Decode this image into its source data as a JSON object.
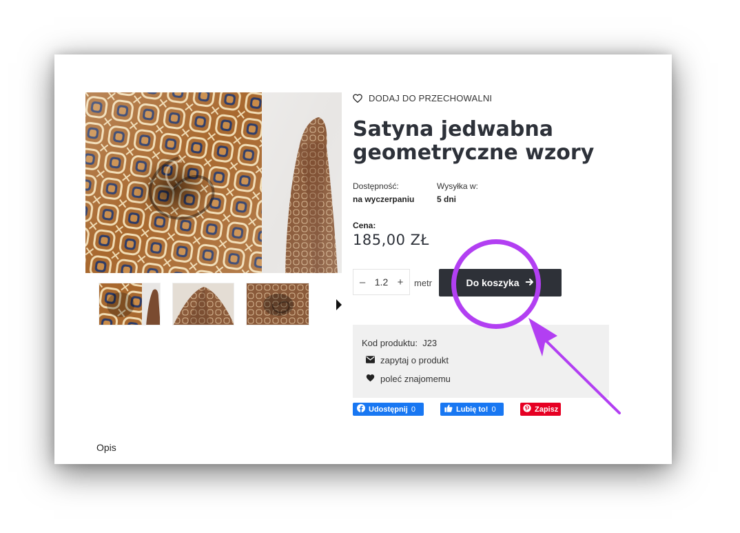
{
  "wishlist": {
    "label": "DODAJ DO PRZECHOWALNI",
    "icon": "heart-outline-icon"
  },
  "product": {
    "title": "Satyna jedwabna geometryczne wzory",
    "availability_label": "Dostępność:",
    "availability_value": "na wyczerpaniu",
    "shipping_label": "Wysyłka w:",
    "shipping_value": "5 dni",
    "price_label": "Cena:",
    "price": "185,00 ZŁ"
  },
  "quantity": {
    "minus": "–",
    "value": "1.2",
    "plus": "+",
    "unit": "metr"
  },
  "cart_button": {
    "label": "Do koszyka",
    "icon": "arrow-right-circle-icon"
  },
  "info": {
    "code_label": "Kod produktu:",
    "code_value": "J23",
    "ask_label": "zapytaj o produkt",
    "recommend_label": "poleć znajomemu"
  },
  "social": {
    "share": {
      "label": "Udostępnij",
      "count": "0"
    },
    "like": {
      "label": "Lubię to!",
      "count": "0"
    },
    "pin": {
      "label": "Zapisz"
    }
  },
  "description_tab": "Opis",
  "colors": {
    "accent": "#b23ff2",
    "button_dark": "#2e3138",
    "facebook": "#1877f2",
    "pinterest": "#e60023",
    "info_bg": "#f0f0f0"
  }
}
